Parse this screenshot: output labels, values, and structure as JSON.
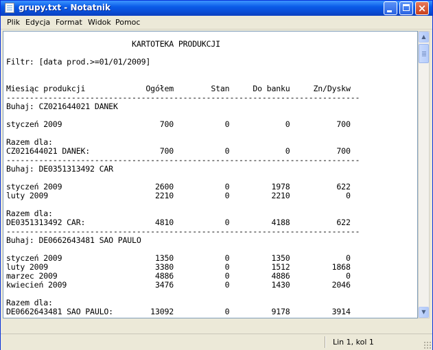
{
  "window": {
    "title": "grupy.txt - Notatnik"
  },
  "menu": [
    {
      "label": "Plik"
    },
    {
      "label": "Edycja"
    },
    {
      "label": "Format"
    },
    {
      "label": "Widok"
    },
    {
      "label": "Pomoc"
    }
  ],
  "document": {
    "lines": [
      "                           KARTOTEKA PRODUKCJI",
      "",
      "Filtr: [data prod.>=01/01/2009]",
      "",
      "",
      "Miesiąc produkcji             Ogółem        Stan     Do banku     Zn/Dyskw",
      "----------------------------------------------------------------------------",
      "Buhaj: CZ021644021 DANEK",
      "",
      "styczeń 2009                     700           0            0          700",
      "",
      "Razem dla:",
      "CZ021644021 DANEK:               700           0            0          700",
      "----------------------------------------------------------------------------",
      "Buhaj: DE0351313492 CAR",
      "",
      "styczeń 2009                    2600           0         1978          622",
      "luty 2009                       2210           0         2210            0",
      "",
      "Razem dla:",
      "DE0351313492 CAR:               4810           0         4188          622",
      "----------------------------------------------------------------------------",
      "Buhaj: DE0662643481 SAO PAULO",
      "",
      "styczeń 2009                    1350           0         1350            0",
      "luty 2009                       3380           0         1512         1868",
      "marzec 2009                     4886           0         4886            0",
      "kwiecień 2009                   3476           0         1430         2046",
      "",
      "Razem dla:",
      "DE0662643481 SAO PAULO:        13092           0         9178         3914"
    ]
  },
  "status": {
    "position": "Lin 1, kol 1"
  },
  "icons": {
    "app": "notepad-icon",
    "minimize": "minimize-icon",
    "maximize": "maximize-icon",
    "close": "close-icon",
    "scroll_up": "scroll-up-arrow-icon",
    "scroll_down": "scroll-down-arrow-icon",
    "grip": "resize-grip-icon"
  },
  "colors": {
    "titlebar": "#0A5BE8",
    "close_button": "#C7401C",
    "window_face": "#ECE9D8"
  }
}
